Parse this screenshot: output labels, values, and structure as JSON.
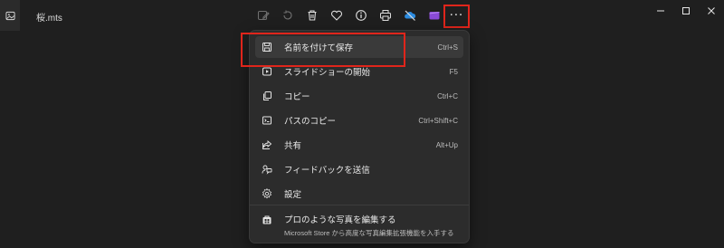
{
  "window": {
    "file_name": "桜.mts"
  },
  "toolbar": {
    "buttons": [
      {
        "icon": "edit-image-icon"
      },
      {
        "icon": "rotate-icon"
      },
      {
        "icon": "delete-icon"
      },
      {
        "icon": "heart-icon"
      },
      {
        "icon": "info-icon"
      },
      {
        "icon": "print-icon"
      },
      {
        "icon": "onedrive-offline-icon"
      },
      {
        "icon": "clipchamp-icon"
      }
    ],
    "more_label": "···"
  },
  "menu": {
    "items": [
      {
        "label": "名前を付けて保存",
        "shortcut": "Ctrl+S",
        "icon": "save-icon"
      },
      {
        "label": "スライドショーの開始",
        "shortcut": "F5",
        "icon": "slideshow-icon"
      },
      {
        "label": "コピー",
        "shortcut": "Ctrl+C",
        "icon": "copy-icon"
      },
      {
        "label": "パスのコピー",
        "shortcut": "Ctrl+Shift+C",
        "icon": "copy-path-icon"
      },
      {
        "label": "共有",
        "shortcut": "Alt+Up",
        "icon": "share-icon"
      },
      {
        "label": "フィードバックを送信",
        "shortcut": "",
        "icon": "feedback-icon"
      },
      {
        "label": "設定",
        "shortcut": "",
        "icon": "settings-icon"
      }
    ],
    "promo": {
      "title": "プロのような写真を編集する",
      "subtitle": "Microsoft Store から高度な写真編集拡張機能を入手する",
      "icon": "store-icon"
    }
  },
  "colors": {
    "highlight": "#e0251b",
    "background": "#1f1f1f",
    "menu_bg": "#2c2c2c"
  }
}
